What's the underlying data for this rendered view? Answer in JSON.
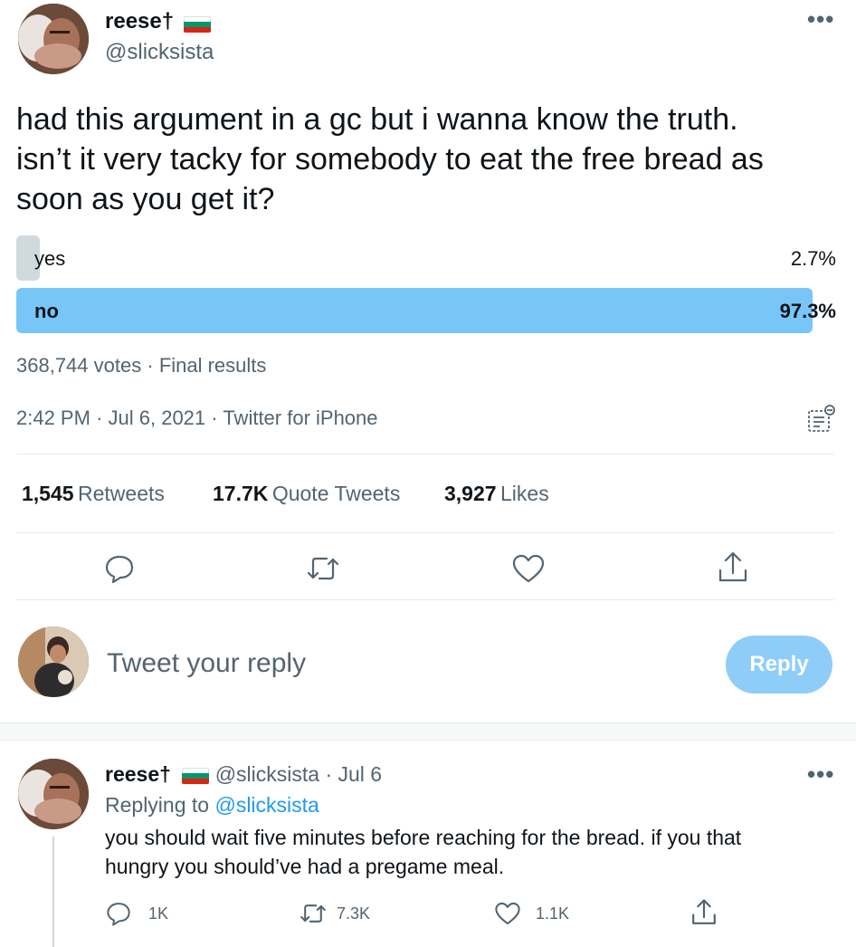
{
  "tweet": {
    "author_name": "reese†",
    "author_handle": "@slicksista",
    "text_lines": [
      "had this argument in a gc but i wanna know the truth.",
      "isn’t it very tacky for somebody to eat the free bread as",
      "soon as you get it?"
    ],
    "poll": {
      "options": [
        {
          "label": "yes",
          "percent": "2.7%",
          "fraction": 0.027
        },
        {
          "label": "no",
          "percent": "97.3%",
          "fraction": 0.973
        }
      ],
      "votes": "368,744 votes",
      "status": "Final results"
    },
    "time": "2:42 PM",
    "date": "Jul 6, 2021",
    "source": "Twitter for iPhone",
    "stats": {
      "retweets_num": "1,545",
      "retweets_lbl": "Retweets",
      "quotes_num": "17.7K",
      "quotes_lbl": "Quote Tweets",
      "likes_num": "3,927",
      "likes_lbl": "Likes"
    }
  },
  "composer": {
    "placeholder": "Tweet your reply",
    "button": "Reply"
  },
  "reply": {
    "author_name": "reese†",
    "author_handle": "@slicksista",
    "date": "Jul 6",
    "replying_prefix": "Replying to",
    "replying_handle": "@slicksista",
    "text_lines": [
      "you should wait five minutes before reaching for the bread. if you that",
      "hungry you should’ve had a pregame meal."
    ],
    "counts": {
      "replies": "1K",
      "retweets": "7.3K",
      "likes": "1.1K"
    }
  },
  "colors": {
    "accent": "#1d9bf0",
    "poll_winner": "#78c6f7",
    "poll_loser": "#cfd9de",
    "reply_button": "#8ecdf8",
    "flag": [
      "#ffffff",
      "#00966e",
      "#d62612"
    ]
  },
  "icons": {
    "more": "more-dots-icon",
    "reply": "reply-bubble-icon",
    "retweet": "retweet-icon",
    "like": "heart-icon",
    "share": "share-icon",
    "analytics": "analytics-icon",
    "flag": "bulgaria-flag-icon"
  }
}
